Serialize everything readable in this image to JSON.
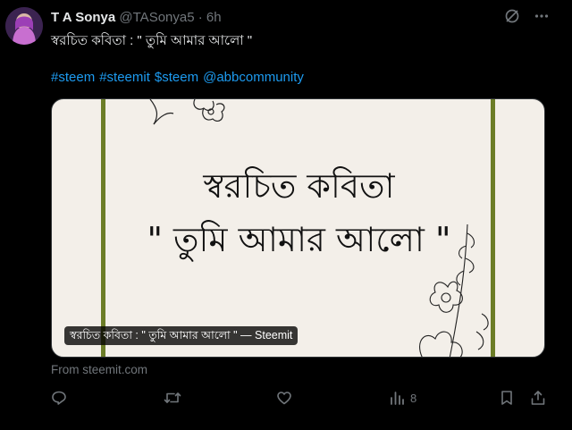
{
  "author": {
    "name": "T A Sonya",
    "handle": "@TASonya5",
    "separator": "·",
    "time": "6h"
  },
  "tweet": {
    "text": "স্বরচিত কবিতা : \" তুমি আমার আলো \"",
    "hashtags": [
      "#steem",
      "#steemit",
      "$steem",
      "@abbcommunity"
    ]
  },
  "card": {
    "image_line1": "স্বরচিত কবিতা",
    "image_line2": "\" তুমি আমার আলো \"",
    "caption": "স্বরচিত কবিতা : \" তুমি আমার আলো \" — Steemit",
    "source": "From steemit.com"
  },
  "actions": {
    "views": "8"
  },
  "icons": {
    "grok": "grok-icon",
    "more": "more-icon",
    "reply": "reply-icon",
    "retweet": "retweet-icon",
    "like": "like-icon",
    "views": "views-icon",
    "bookmark": "bookmark-icon",
    "share": "share-icon"
  },
  "colors": {
    "background": "#000000",
    "text": "#e7e9ea",
    "muted": "#71767b",
    "link": "#1d9bf0",
    "card_bg": "#f3efe9",
    "frame": "#6c7d27"
  }
}
